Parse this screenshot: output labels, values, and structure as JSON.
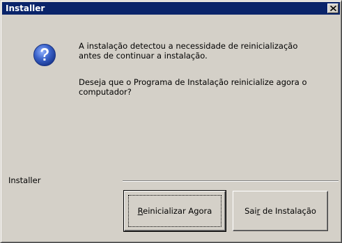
{
  "window": {
    "title": "Installer"
  },
  "icons": {
    "message_icon": "question-icon",
    "close_icon": "close-icon"
  },
  "message": {
    "line1": "A instalação detectou a necessidade de reinicialização",
    "line2": "antes de continuar a instalação.",
    "line3": "Deseja que o Programa de Instalação reinicialize agora o",
    "line4": "computador?"
  },
  "footer": {
    "group_label": "Installer"
  },
  "buttons": {
    "restart_accel": "R",
    "restart_rest": "einicializar Agora",
    "exit_pre": "Sai",
    "exit_accel": "r",
    "exit_post": " de Instalação"
  },
  "colors": {
    "titlebar": "#0a246a",
    "face": "#d4d0c8",
    "icon_blue": "#2f56b6"
  }
}
